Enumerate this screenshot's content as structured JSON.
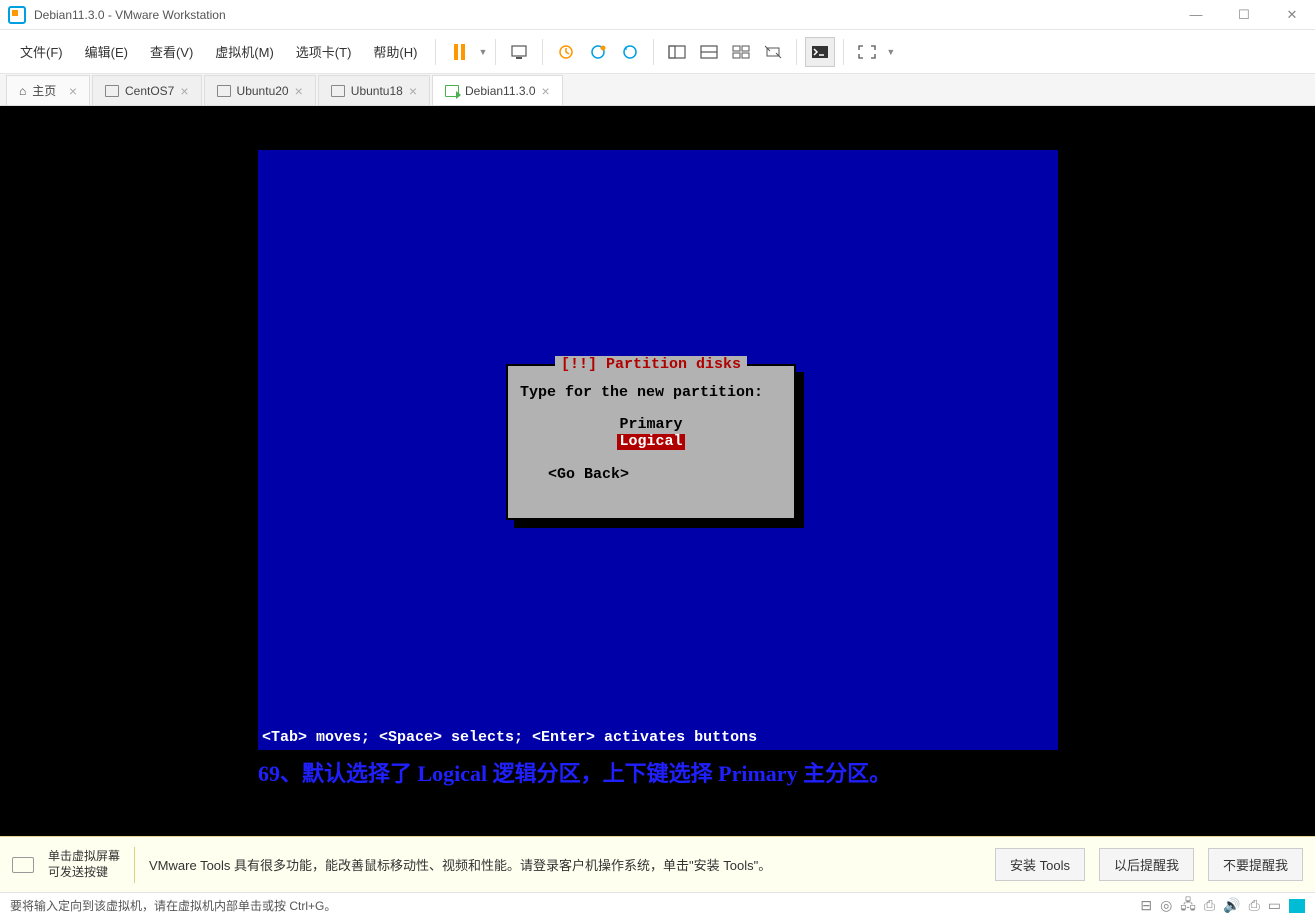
{
  "window": {
    "title": "Debian11.3.0 - VMware Workstation"
  },
  "menu": {
    "file": "文件(F)",
    "edit": "编辑(E)",
    "view": "查看(V)",
    "vm": "虚拟机(M)",
    "tabs": "选项卡(T)",
    "help": "帮助(H)"
  },
  "tabs": {
    "home": "主页",
    "items": [
      {
        "label": "CentOS7"
      },
      {
        "label": "Ubuntu20"
      },
      {
        "label": "Ubuntu18"
      },
      {
        "label": "Debian11.3.0"
      }
    ]
  },
  "installer": {
    "dialog_title": "[!!] Partition disks",
    "prompt": "Type for the new partition:",
    "option_primary": "Primary",
    "option_logical": "Logical",
    "go_back": "<Go Back>",
    "nav_hint": "<Tab> moves; <Space> selects; <Enter> activates buttons"
  },
  "caption": "69、默认选择了 Logical 逻辑分区，上下键选择 Primary 主分区。",
  "infobar": {
    "hint_line1": "单击虚拟屏幕",
    "hint_line2": "可发送按键",
    "message": "VMware Tools 具有很多功能，能改善鼠标移动性、视频和性能。请登录客户机操作系统，单击\"安装 Tools\"。",
    "btn_install": "安装 Tools",
    "btn_later": "以后提醒我",
    "btn_never": "不要提醒我"
  },
  "statusbar": {
    "message": "要将输入定向到该虚拟机，请在虚拟机内部单击或按 Ctrl+G。"
  }
}
